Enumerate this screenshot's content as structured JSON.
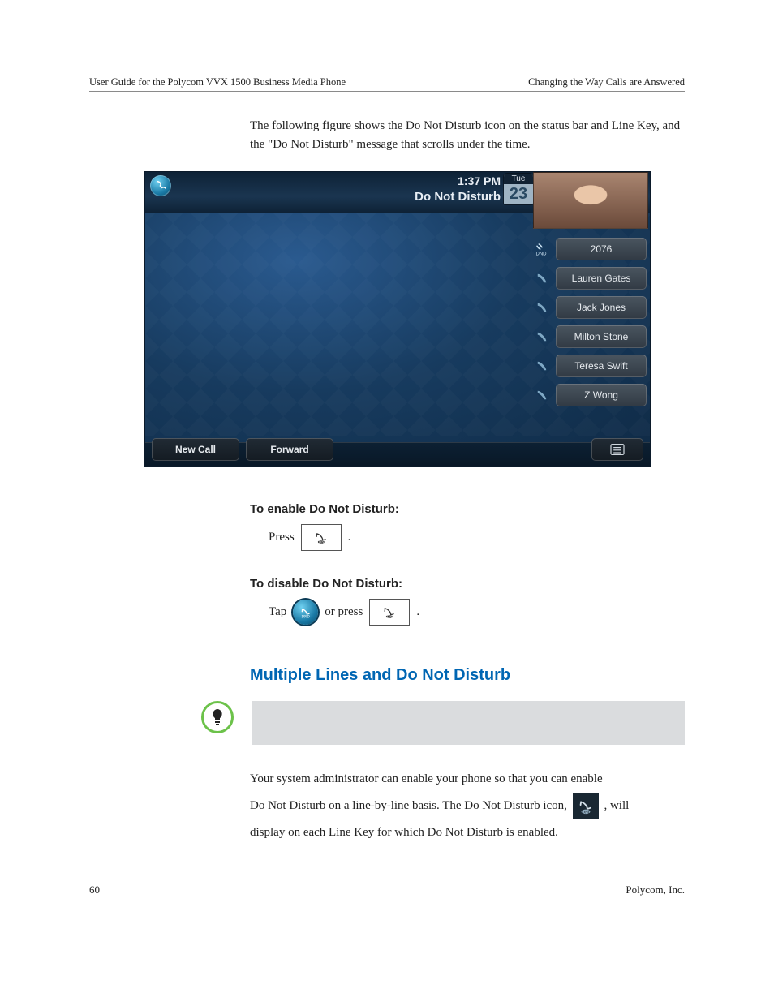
{
  "header": {
    "left": "User Guide for the Polycom VVX 1500 Business Media Phone",
    "right": "Changing the Way Calls are Answered"
  },
  "intro": "The following figure shows the Do Not Disturb icon on the status bar and Line Key, and the \"Do Not Disturb\" message that scrolls under the time.",
  "phone": {
    "time": "1:37 PM",
    "status": "Do Not Disturb",
    "dow": "Tue",
    "day": "23",
    "dnd_badge": "DND",
    "line": "2076",
    "contacts": [
      "Lauren Gates",
      "Jack Jones",
      "Milton Stone",
      "Teresa Swift",
      "Z Wong"
    ],
    "soft": {
      "new_call": "New Call",
      "forward": "Forward"
    }
  },
  "enable_h": "To enable Do Not Disturb:",
  "enable_step_press": "Press",
  "disable_h": "To disable Do Not Disturb:",
  "disable_step_tap": "Tap",
  "disable_step_or_press": "or press",
  "section_h": "Multiple Lines and Do Not Disturb",
  "para_a": "Your system administrator can enable your phone so that you can enable",
  "para_b": "Do Not Disturb on a line-by-line basis. The Do Not Disturb icon,",
  "para_c": ", will",
  "para_d": "display on each Line Key for which Do Not Disturb is enabled.",
  "footer": {
    "page": "60",
    "org": "Polycom, Inc."
  }
}
